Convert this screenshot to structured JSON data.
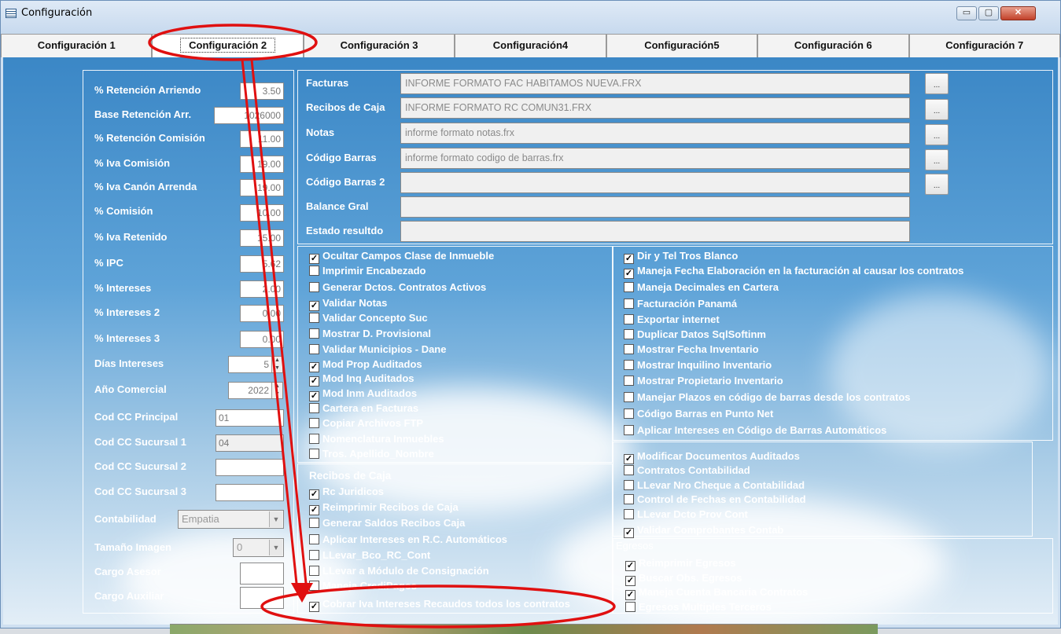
{
  "window": {
    "title": "Configuración",
    "controls": {
      "minimize": "▭",
      "maximize": "▢",
      "close": "✕"
    }
  },
  "tabs": [
    "Configuración 1",
    "Configuración 2",
    "Configuración 3",
    "Configuración4",
    "Configuración5",
    "Configuración 6",
    "Configuración 7"
  ],
  "active_tab": "Configuración 2",
  "left_fields": {
    "retencion_arriendo": {
      "label": "% Retención Arriendo",
      "value": "3.50"
    },
    "base_retencion": {
      "label": "Base Retención Arr.",
      "value": "1026000"
    },
    "retencion_comision": {
      "label": "% Retención Comisión",
      "value": "11.00"
    },
    "iva_comision": {
      "label": "% Iva Comisión",
      "value": "19.00"
    },
    "iva_canon": {
      "label": "% Iva Canón Arrenda",
      "value": "19.00"
    },
    "comision": {
      "label": "% Comisión",
      "value": "10.00"
    },
    "iva_retenido": {
      "label": "% Iva Retenido",
      "value": "15.00"
    },
    "ipc": {
      "label": "% IPC",
      "value": "5.62"
    },
    "intereses": {
      "label": "% Intereses",
      "value": "2.00"
    },
    "intereses2": {
      "label": "% Intereses 2",
      "value": "0.00"
    },
    "intereses3": {
      "label": "% Intereses 3",
      "value": "0.00"
    },
    "dias_intereses": {
      "label": "Días Intereses",
      "value": "5"
    },
    "anio_comercial": {
      "label": "Año Comercial",
      "value": "2022"
    },
    "cc_principal": {
      "label": "Cod CC Principal",
      "value": "01"
    },
    "cc_sucursal1": {
      "label": "Cod CC Sucursal 1",
      "value": "04"
    },
    "cc_sucursal2": {
      "label": "Cod CC Sucursal 2",
      "value": ""
    },
    "cc_sucursal3": {
      "label": "Cod CC Sucursal 3",
      "value": ""
    },
    "contabilidad": {
      "label": "Contabilidad",
      "value": "Empatia"
    },
    "tamano_imagen": {
      "label": "Tamaño Imagen",
      "value": "0"
    },
    "cargo_asesor": {
      "label": "Cargo Asesor",
      "value": ""
    },
    "cargo_auxiliar": {
      "label": "Cargo Auxiliar",
      "value": ""
    }
  },
  "reports": [
    {
      "label": "Facturas",
      "value": "INFORME FORMATO FAC HABITAMOS NUEVA.FRX",
      "button": "..."
    },
    {
      "label": "Recibos de Caja",
      "value": "INFORME FORMATO RC COMUN31.FRX",
      "button": "..."
    },
    {
      "label": "Notas",
      "value": "informe formato notas.frx",
      "button": "..."
    },
    {
      "label": "Código Barras",
      "value": "informe formato codigo de barras.frx",
      "button": "..."
    },
    {
      "label": "Código Barras 2",
      "value": "",
      "button": "..."
    },
    {
      "label": "Balance Gral",
      "value": ""
    },
    {
      "label": "Estado resultdo",
      "value": ""
    }
  ],
  "check_left": [
    {
      "label": "Ocultar Campos Clase de Inmueble",
      "checked": true
    },
    {
      "label": "Imprimir Encabezado",
      "checked": false
    },
    {
      "label": "Generar Dctos. Contratos Activos",
      "checked": false
    },
    {
      "label": "Validar Notas",
      "checked": true
    },
    {
      "label": "Validar Concepto Suc",
      "checked": false
    },
    {
      "label": "Mostrar D. Provisional",
      "checked": false
    },
    {
      "label": "Validar Municipios - Dane",
      "checked": false
    },
    {
      "label": "Mod Prop Auditados",
      "checked": true
    },
    {
      "label": "Mod Inq Auditados",
      "checked": true
    },
    {
      "label": "Mod Inm Auditados",
      "checked": true
    },
    {
      "label": "Cartera en Facturas",
      "checked": false
    },
    {
      "label": "Copiar Archivos FTP",
      "checked": false
    },
    {
      "label": "Nomenclatura Inmuebles",
      "checked": false
    },
    {
      "label": "Tros. Apellido_Nombre",
      "checked": false
    }
  ],
  "check_right": [
    {
      "label": "Dir y Tel Tros Blanco",
      "checked": true
    },
    {
      "label": "Maneja Fecha Elaboración en la facturación al causar los contratos",
      "checked": true
    },
    {
      "label": "Maneja Decimales en Cartera",
      "checked": false
    },
    {
      "label": "Facturación Panamá",
      "checked": false
    },
    {
      "label": "Exportar internet",
      "checked": false
    },
    {
      "label": "Duplicar Datos SqlSoftinm",
      "checked": false
    },
    {
      "label": "Mostrar Fecha Inventario",
      "checked": false
    },
    {
      "label": "Mostrar Inquilino Inventario",
      "checked": false
    },
    {
      "label": "Mostrar Propietario Inventario",
      "checked": false
    },
    {
      "label": "Manejar Plazos en código de barras desde los contratos",
      "checked": false
    },
    {
      "label": "Código Barras en Punto Net",
      "checked": false
    },
    {
      "label": "Aplicar Intereses en Código de Barras Automáticos",
      "checked": false
    }
  ],
  "recibos": {
    "title": "Recibos de Caja",
    "items": [
      {
        "label": "Rc Juridicos",
        "checked": true
      },
      {
        "label": "Reimprimir Recibos de Caja",
        "checked": true
      },
      {
        "label": "Generar Saldos Recibos Caja",
        "checked": false
      },
      {
        "label": "Aplicar Intereses en R.C. Automáticos",
        "checked": false
      },
      {
        "label": "LLevar_Bco_RC_Cont",
        "checked": false
      },
      {
        "label": "LLevar a Módulo de Consignación",
        "checked": false
      },
      {
        "label": "Maneja CrediPagos",
        "checked": false
      },
      {
        "label": "Cobrar Iva Intereses Recaudos todos los contratos",
        "checked": true
      }
    ]
  },
  "contab": [
    {
      "label": "Modificar Documentos Auditados",
      "checked": true
    },
    {
      "label": "Contratos Contabilidad",
      "checked": false
    },
    {
      "label": "LLevar Nro Cheque a Contabilidad",
      "checked": false
    },
    {
      "label": "Control de Fechas en Contabilidad",
      "checked": false
    },
    {
      "label": "LLevar Dcto Prov Cont",
      "checked": false
    },
    {
      "label": "Validar Comprobantes Contab",
      "checked": true
    }
  ],
  "egresos": {
    "title": "Egresos",
    "items": [
      {
        "label": "Reimprimir Egresos",
        "checked": true
      },
      {
        "label": "Buscar Obs. Egresos",
        "checked": true
      },
      {
        "label": "Maneja Cuenta Bancaria Contratos",
        "checked": true
      },
      {
        "label": "Egresos Multiples Terceros",
        "checked": false
      }
    ]
  },
  "glyphs": {
    "check": "✓",
    "dropdown": "▼",
    "spin_up": "▲",
    "spin_down": "▼"
  },
  "colors": {
    "annotation": "#e01010",
    "label_text": "#ffffff"
  }
}
